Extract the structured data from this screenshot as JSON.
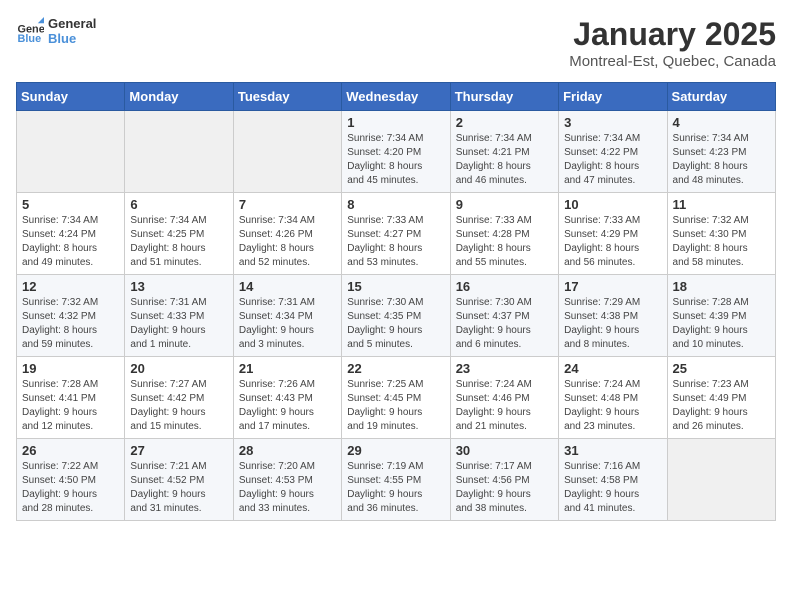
{
  "header": {
    "logo_general": "General",
    "logo_blue": "Blue",
    "title": "January 2025",
    "subtitle": "Montreal-Est, Quebec, Canada"
  },
  "days_of_week": [
    "Sunday",
    "Monday",
    "Tuesday",
    "Wednesday",
    "Thursday",
    "Friday",
    "Saturday"
  ],
  "weeks": [
    [
      {
        "day": "",
        "info": ""
      },
      {
        "day": "",
        "info": ""
      },
      {
        "day": "",
        "info": ""
      },
      {
        "day": "1",
        "info": "Sunrise: 7:34 AM\nSunset: 4:20 PM\nDaylight: 8 hours\nand 45 minutes."
      },
      {
        "day": "2",
        "info": "Sunrise: 7:34 AM\nSunset: 4:21 PM\nDaylight: 8 hours\nand 46 minutes."
      },
      {
        "day": "3",
        "info": "Sunrise: 7:34 AM\nSunset: 4:22 PM\nDaylight: 8 hours\nand 47 minutes."
      },
      {
        "day": "4",
        "info": "Sunrise: 7:34 AM\nSunset: 4:23 PM\nDaylight: 8 hours\nand 48 minutes."
      }
    ],
    [
      {
        "day": "5",
        "info": "Sunrise: 7:34 AM\nSunset: 4:24 PM\nDaylight: 8 hours\nand 49 minutes."
      },
      {
        "day": "6",
        "info": "Sunrise: 7:34 AM\nSunset: 4:25 PM\nDaylight: 8 hours\nand 51 minutes."
      },
      {
        "day": "7",
        "info": "Sunrise: 7:34 AM\nSunset: 4:26 PM\nDaylight: 8 hours\nand 52 minutes."
      },
      {
        "day": "8",
        "info": "Sunrise: 7:33 AM\nSunset: 4:27 PM\nDaylight: 8 hours\nand 53 minutes."
      },
      {
        "day": "9",
        "info": "Sunrise: 7:33 AM\nSunset: 4:28 PM\nDaylight: 8 hours\nand 55 minutes."
      },
      {
        "day": "10",
        "info": "Sunrise: 7:33 AM\nSunset: 4:29 PM\nDaylight: 8 hours\nand 56 minutes."
      },
      {
        "day": "11",
        "info": "Sunrise: 7:32 AM\nSunset: 4:30 PM\nDaylight: 8 hours\nand 58 minutes."
      }
    ],
    [
      {
        "day": "12",
        "info": "Sunrise: 7:32 AM\nSunset: 4:32 PM\nDaylight: 8 hours\nand 59 minutes."
      },
      {
        "day": "13",
        "info": "Sunrise: 7:31 AM\nSunset: 4:33 PM\nDaylight: 9 hours\nand 1 minute."
      },
      {
        "day": "14",
        "info": "Sunrise: 7:31 AM\nSunset: 4:34 PM\nDaylight: 9 hours\nand 3 minutes."
      },
      {
        "day": "15",
        "info": "Sunrise: 7:30 AM\nSunset: 4:35 PM\nDaylight: 9 hours\nand 5 minutes."
      },
      {
        "day": "16",
        "info": "Sunrise: 7:30 AM\nSunset: 4:37 PM\nDaylight: 9 hours\nand 6 minutes."
      },
      {
        "day": "17",
        "info": "Sunrise: 7:29 AM\nSunset: 4:38 PM\nDaylight: 9 hours\nand 8 minutes."
      },
      {
        "day": "18",
        "info": "Sunrise: 7:28 AM\nSunset: 4:39 PM\nDaylight: 9 hours\nand 10 minutes."
      }
    ],
    [
      {
        "day": "19",
        "info": "Sunrise: 7:28 AM\nSunset: 4:41 PM\nDaylight: 9 hours\nand 12 minutes."
      },
      {
        "day": "20",
        "info": "Sunrise: 7:27 AM\nSunset: 4:42 PM\nDaylight: 9 hours\nand 15 minutes."
      },
      {
        "day": "21",
        "info": "Sunrise: 7:26 AM\nSunset: 4:43 PM\nDaylight: 9 hours\nand 17 minutes."
      },
      {
        "day": "22",
        "info": "Sunrise: 7:25 AM\nSunset: 4:45 PM\nDaylight: 9 hours\nand 19 minutes."
      },
      {
        "day": "23",
        "info": "Sunrise: 7:24 AM\nSunset: 4:46 PM\nDaylight: 9 hours\nand 21 minutes."
      },
      {
        "day": "24",
        "info": "Sunrise: 7:24 AM\nSunset: 4:48 PM\nDaylight: 9 hours\nand 23 minutes."
      },
      {
        "day": "25",
        "info": "Sunrise: 7:23 AM\nSunset: 4:49 PM\nDaylight: 9 hours\nand 26 minutes."
      }
    ],
    [
      {
        "day": "26",
        "info": "Sunrise: 7:22 AM\nSunset: 4:50 PM\nDaylight: 9 hours\nand 28 minutes."
      },
      {
        "day": "27",
        "info": "Sunrise: 7:21 AM\nSunset: 4:52 PM\nDaylight: 9 hours\nand 31 minutes."
      },
      {
        "day": "28",
        "info": "Sunrise: 7:20 AM\nSunset: 4:53 PM\nDaylight: 9 hours\nand 33 minutes."
      },
      {
        "day": "29",
        "info": "Sunrise: 7:19 AM\nSunset: 4:55 PM\nDaylight: 9 hours\nand 36 minutes."
      },
      {
        "day": "30",
        "info": "Sunrise: 7:17 AM\nSunset: 4:56 PM\nDaylight: 9 hours\nand 38 minutes."
      },
      {
        "day": "31",
        "info": "Sunrise: 7:16 AM\nSunset: 4:58 PM\nDaylight: 9 hours\nand 41 minutes."
      },
      {
        "day": "",
        "info": ""
      }
    ]
  ]
}
